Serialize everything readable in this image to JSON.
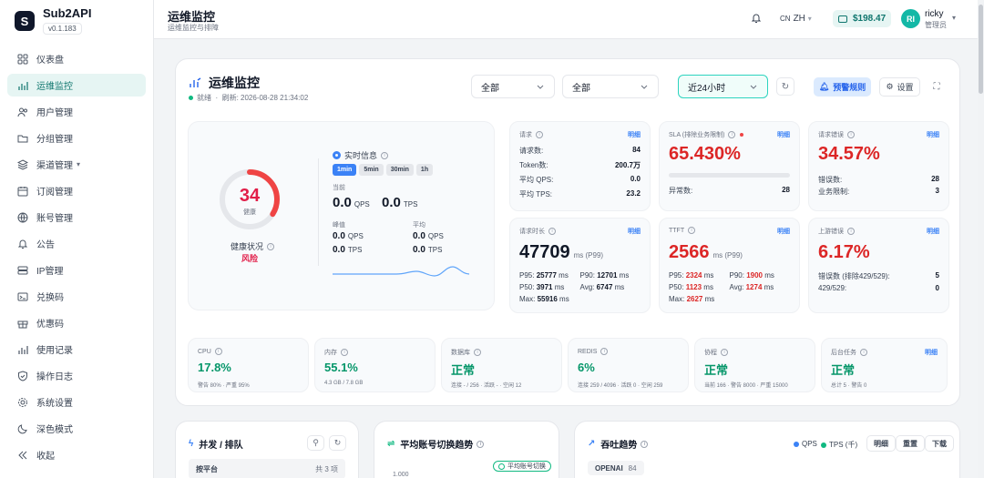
{
  "brand": {
    "name": "Sub2API",
    "version": "v0.1.183"
  },
  "sidebar": {
    "items": [
      {
        "label": "仪表盘"
      },
      {
        "label": "运维监控"
      },
      {
        "label": "用户管理"
      },
      {
        "label": "分组管理"
      },
      {
        "label": "渠道管理"
      },
      {
        "label": "订阅管理"
      },
      {
        "label": "账号管理"
      },
      {
        "label": "公告"
      },
      {
        "label": "IP管理"
      },
      {
        "label": "兑换码"
      },
      {
        "label": "优惠码"
      },
      {
        "label": "使用记录"
      },
      {
        "label": "操作日志"
      },
      {
        "label": "系统设置"
      }
    ],
    "dark_mode": "深色模式",
    "collapse": "收起"
  },
  "topbar": {
    "title": "运维监控",
    "subtitle": "运维监控与排障",
    "lang_flag": "CN",
    "lang": "ZH",
    "balance": "$198.47",
    "user": {
      "initials": "RI",
      "name": "ricky",
      "role": "管理员"
    }
  },
  "panel": {
    "title": "运维监控",
    "status": "就绪",
    "sep": "·",
    "refresh": "刷新: 2026-08-28 21:34:02",
    "filter1": "全部",
    "filter2": "全部",
    "time_range": "近24小时",
    "alert_rules": "预警规则",
    "settings": "设置"
  },
  "health": {
    "score": "34",
    "score_value": 34,
    "score_label": "健康",
    "status_label": "健康状况",
    "status_value": "风险",
    "realtime": "实时信息",
    "windows": [
      "1min",
      "5min",
      "30min",
      "1h"
    ],
    "current_label": "当前",
    "current_qps": "0.0",
    "current_tps": "0.0",
    "peak_label": "峰值",
    "avg_label": "平均",
    "peak_qps": "0.0",
    "peak_tps": "0.0",
    "avg_qps": "0.0",
    "avg_tps": "0.0",
    "unit_qps": "QPS",
    "unit_tps": "TPS"
  },
  "requests": {
    "label": "请求",
    "link": "明细",
    "rows": [
      {
        "k": "请求数:",
        "v": "84"
      },
      {
        "k": "Token数:",
        "v": "200.7万"
      },
      {
        "k": "平均 QPS:",
        "v": "0.0"
      },
      {
        "k": "平均 TPS:",
        "v": "23.2"
      }
    ]
  },
  "sla": {
    "label": "SLA (排除业务限制)",
    "link": "明细",
    "value": "65.430%",
    "progress": 0.6543,
    "anomaly_label": "异常数:",
    "anomaly": "28"
  },
  "errors": {
    "label": "请求错误",
    "link": "明细",
    "value": "34.57%",
    "rows": [
      {
        "k": "错误数:",
        "v": "28"
      },
      {
        "k": "业务限制:",
        "v": "3"
      }
    ]
  },
  "latency": {
    "label": "请求时长",
    "link": "明细",
    "value": "47709",
    "unit": "ms (P99)",
    "p95": "25777",
    "p90": "12701",
    "p50": "3971",
    "avg": "6747",
    "max": "55916",
    "ms": "ms"
  },
  "ttft": {
    "label": "TTFT",
    "link": "明细",
    "value": "2566",
    "unit": "ms (P99)",
    "p95": "2324",
    "p90": "1900",
    "p50": "1123",
    "avg": "1274",
    "max": "2627",
    "ms": "ms"
  },
  "upstream": {
    "label": "上游错误",
    "link": "明细",
    "value": "6.17%",
    "rows": [
      {
        "k": "错误数 (排除429/529):",
        "v": "5"
      },
      {
        "k": "429/529:",
        "v": "0"
      }
    ]
  },
  "resources": [
    {
      "label": "CPU",
      "value": "17.8%",
      "detail": "警告 80% · 严重 95%"
    },
    {
      "label": "内存",
      "value": "55.1%",
      "detail": "4.3 GB / 7.8 GB"
    },
    {
      "label": "数据库",
      "value": "正常",
      "detail": "连接 - / 256 · 活跃 - · 空闲 12"
    },
    {
      "label": "REDIS",
      "value": "6%",
      "detail": "连接 259 / 4096 · 活跃 0 · 空闲 259"
    },
    {
      "label": "协程",
      "value": "正常",
      "detail": "当前 166 · 警告 8000 · 严重 15000"
    },
    {
      "label": "后台任务",
      "value": "正常",
      "detail": "总计 5 · 警告 0",
      "link": "明细"
    }
  ],
  "concurrency": {
    "title": "并发 / 排队",
    "table_head": "按平台",
    "count": "共 3 项"
  },
  "switch_trend": {
    "title": "平均账号切换趋势",
    "legend": "平均账号切换",
    "y_tick": "1.000"
  },
  "throughput": {
    "title": "吞吐趋势",
    "legend_qps": "QPS",
    "legend_tps": "TPS (千)",
    "detail": "明细",
    "reset": "重置",
    "download": "下载",
    "platform": "OPENAI",
    "platform_count": "84"
  },
  "colors": {
    "accent": "#14b8a6",
    "danger": "#dc2626",
    "success": "#059669",
    "primary": "#3b82f6"
  }
}
